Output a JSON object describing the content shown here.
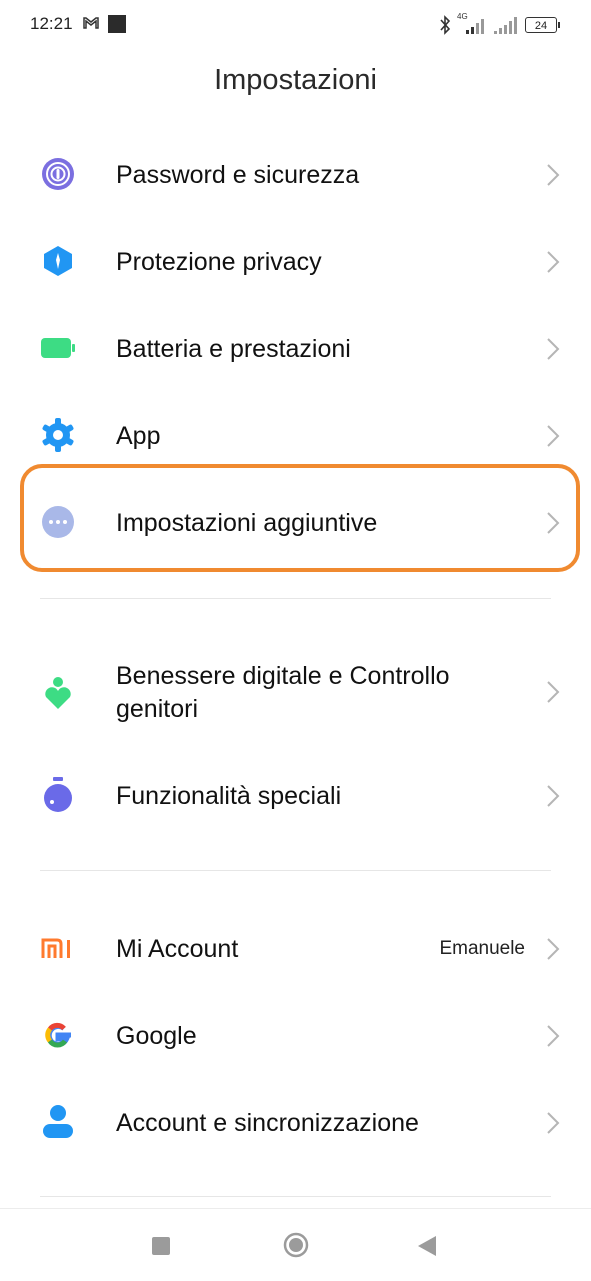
{
  "status_bar": {
    "time": "12:21",
    "network_label": "4G",
    "battery": "24"
  },
  "header": {
    "title": "Impostazioni"
  },
  "section1": [
    {
      "label": "Password e sicurezza",
      "icon": "fingerprint-icon",
      "color": "#7b6fe0"
    },
    {
      "label": "Protezione privacy",
      "icon": "privacy-shield-icon",
      "color": "#2196f3"
    },
    {
      "label": "Batteria e prestazioni",
      "icon": "battery-icon",
      "color": "#3ddc84"
    },
    {
      "label": "App",
      "icon": "gear-icon",
      "color": "#2196f3"
    },
    {
      "label": "Impostazioni aggiuntive",
      "icon": "more-dots-icon",
      "color": "#a9b8e8"
    }
  ],
  "section2": [
    {
      "label_line1": "Benessere digitale e Controllo",
      "label_line2": "genitori",
      "icon": "digital-wellbeing-icon",
      "color": "#3ddc84"
    },
    {
      "label": "Funzionalità speciali",
      "icon": "special-features-icon",
      "color": "#6a6ae8"
    }
  ],
  "section3": [
    {
      "label": "Mi Account",
      "value": "Emanuele",
      "icon": "mi-logo-icon",
      "color": "#ff7a2e"
    },
    {
      "label": "Google",
      "icon": "google-icon"
    },
    {
      "label": "Account e sincronizzazione",
      "icon": "account-icon",
      "color": "#2196f3"
    }
  ],
  "highlight_color": "#f08a30"
}
